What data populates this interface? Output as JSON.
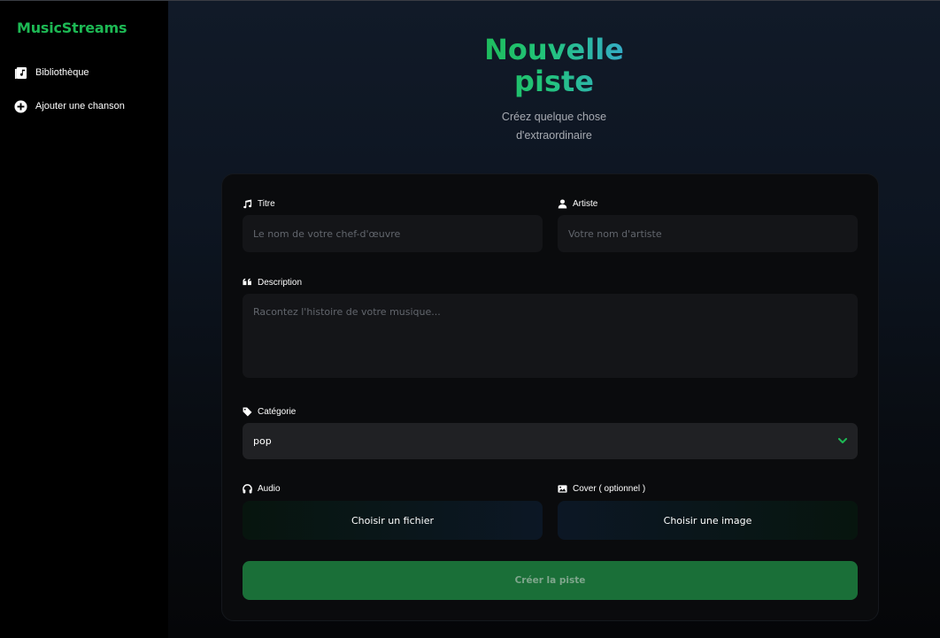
{
  "sidebar": {
    "brand": "MusicStreams",
    "items": [
      {
        "label": "Bibliothèque",
        "icon": "library-icon"
      },
      {
        "label": "Ajouter une chanson",
        "icon": "plus-circle-icon"
      }
    ]
  },
  "hero": {
    "title": "Nouvelle piste",
    "subtitle": "Créez quelque chose d'extraordinaire"
  },
  "form": {
    "title": {
      "label": "Titre",
      "icon": "music-note-icon",
      "placeholder": "Le nom de votre chef-d'œuvre",
      "value": ""
    },
    "artist": {
      "label": "Artiste",
      "icon": "user-icon",
      "placeholder": "Votre nom d'artiste",
      "value": ""
    },
    "description": {
      "label": "Description",
      "icon": "quote-icon",
      "placeholder": "Racontez l'histoire de votre musique...",
      "value": ""
    },
    "category": {
      "label": "Catégorie",
      "icon": "tag-icon",
      "value": "pop"
    },
    "audio": {
      "label": "Audio",
      "icon": "headphones-icon",
      "button": "Choisir un fichier"
    },
    "cover": {
      "label": "Cover ( optionnel )",
      "icon": "image-icon",
      "button": "Choisir une image"
    },
    "submit": "Créer la piste"
  },
  "colors": {
    "accent": "#1db954",
    "submit_bg": "#1a6f38",
    "card_bg": "#0a0b0d",
    "input_bg": "#141518"
  }
}
